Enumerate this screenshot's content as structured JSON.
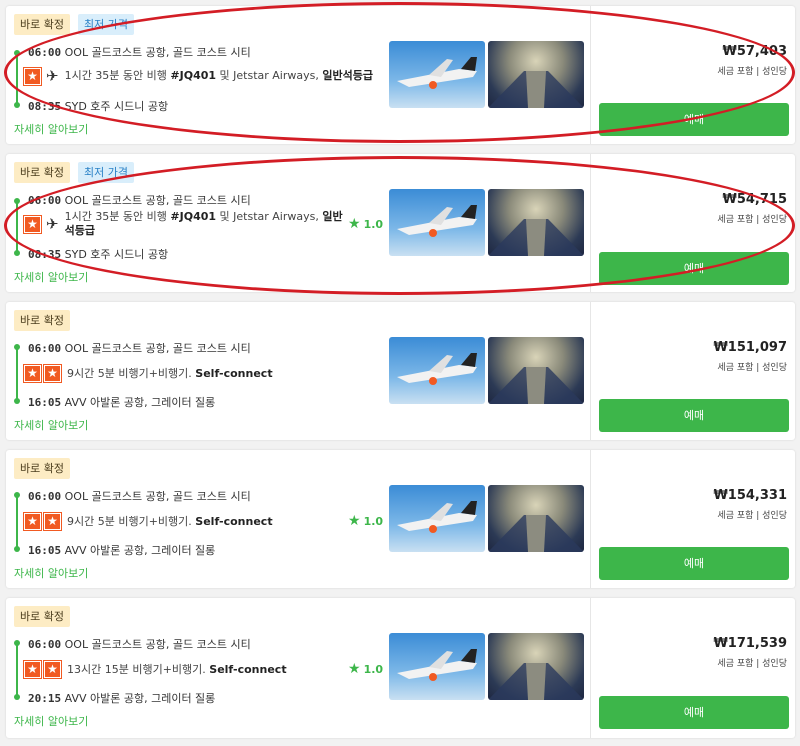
{
  "results": [
    {
      "badges": [
        "바로 확정",
        "최저 가격"
      ],
      "depart_time": "06:00",
      "depart_place": "OOL 골드코스트 공항, 골드 코스트 시티",
      "duration": "1시간 35분 동안 비행",
      "flight_no": "#JQ401",
      "airline_text": "및 Jetstar Airways,",
      "cabin": "일반석등급",
      "rating": "",
      "arrive_time": "08:35",
      "arrive_place": "SYD 호주 시드니 공항",
      "details_link": "자세히 알아보기",
      "price": "₩57,403",
      "price_note": "세금 포함 | 성인당",
      "book_label": "예매"
    },
    {
      "badges": [
        "바로 확정",
        "최저 가격"
      ],
      "depart_time": "06:00",
      "depart_place": "OOL 골드코스트 공항, 골드 코스트 시티",
      "duration": "1시간 35분 동안 비행",
      "flight_no": "#JQ401",
      "airline_text": "및 Jetstar Airways,",
      "cabin": "일반석등급",
      "rating": "1.0",
      "arrive_time": "08:35",
      "arrive_place": "SYD 호주 시드니 공항",
      "details_link": "자세히 알아보기",
      "price": "₩54,715",
      "price_note": "세금 포함 | 성인당",
      "book_label": "예매"
    },
    {
      "badges": [
        "바로 확정"
      ],
      "depart_time": "06:00",
      "depart_place": "OOL 골드코스트 공항, 골드 코스트 시티",
      "duration": "9시간 5분 비행기+비행기.",
      "connect": "Self-connect",
      "rating": "",
      "arrive_time": "16:05",
      "arrive_place": "AVV 아발론 공항, 그레이터 질롱",
      "details_link": "자세히 알아보기",
      "price": "₩151,097",
      "price_note": "세금 포함 | 성인당",
      "book_label": "예매"
    },
    {
      "badges": [
        "바로 확정"
      ],
      "depart_time": "06:00",
      "depart_place": "OOL 골드코스트 공항, 골드 코스트 시티",
      "duration": "9시간 5분 비행기+비행기.",
      "connect": "Self-connect",
      "rating": "1.0",
      "arrive_time": "16:05",
      "arrive_place": "AVV 아발론 공항, 그레이터 질롱",
      "details_link": "자세히 알아보기",
      "price": "₩154,331",
      "price_note": "세금 포함 | 성인당",
      "book_label": "예매"
    },
    {
      "badges": [
        "바로 확정"
      ],
      "depart_time": "06:00",
      "depart_place": "OOL 골드코스트 공항, 골드 코스트 시티",
      "duration": "13시간 15분 비행기+비행기.",
      "connect": "Self-connect",
      "rating": "1.0",
      "arrive_time": "20:15",
      "arrive_place": "AVV 아발론 공항, 그레이터 질롱",
      "details_link": "자세히 알아보기",
      "price": "₩171,539",
      "price_note": "세금 포함 | 성인당",
      "book_label": "예매"
    }
  ],
  "icons": {
    "airline_logo": "jetstar-star-icon",
    "plane": "airplane-icon",
    "rating_star": "star-icon"
  },
  "colors": {
    "accent_green": "#3db64a",
    "annotation_red": "#d31d25",
    "jetstar_orange": "#f15a22",
    "badge_confirm_bg": "#fdecc4",
    "badge_lowest_bg": "#d9eefb"
  }
}
